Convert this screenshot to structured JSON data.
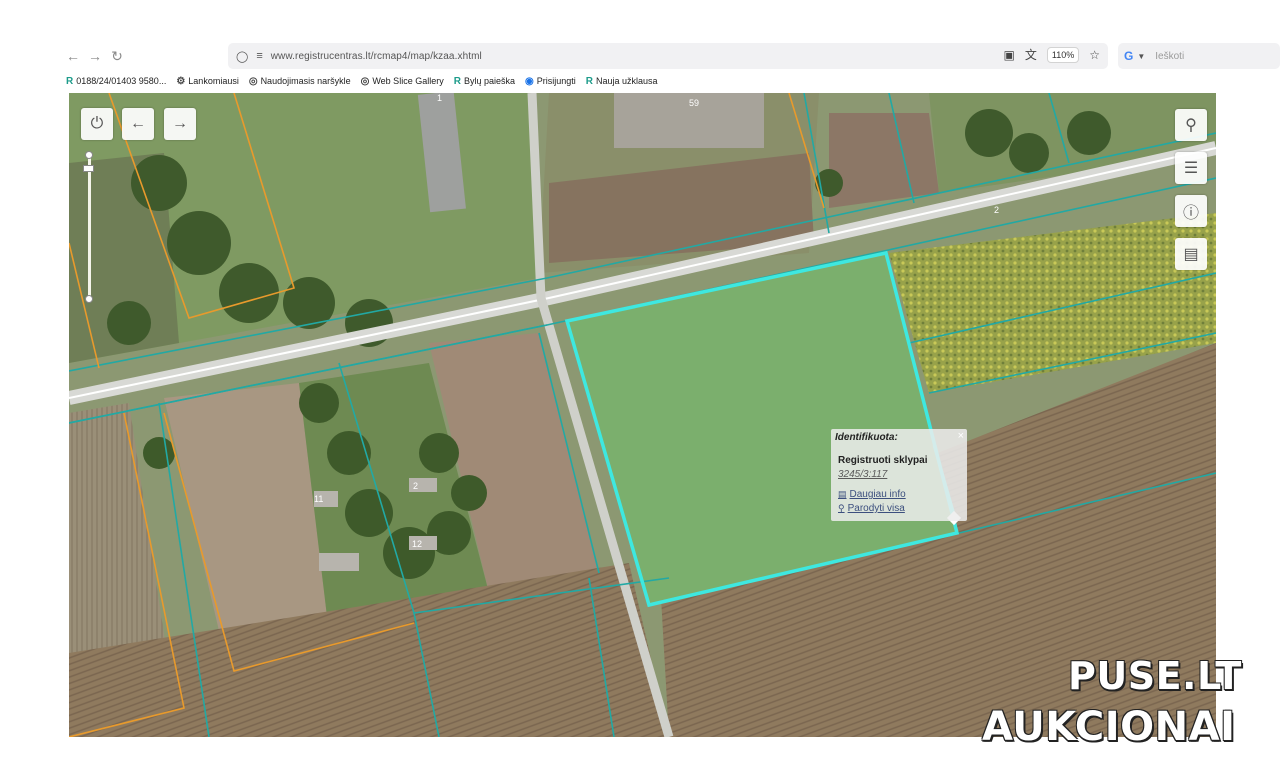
{
  "browser": {
    "url": "www.registrucentras.lt/rcmap4/map/kzaa.xhtml",
    "zoom": "110%",
    "search_placeholder": "Ieškoti",
    "search_engine": "G"
  },
  "bookmarks": [
    {
      "label": "0188/24/01403  9580...",
      "icon": "registrucentras-icon"
    },
    {
      "label": "Lankomiausi",
      "icon": "gear-icon"
    },
    {
      "label": "Naudojimasis naršykle",
      "icon": "globe-icon"
    },
    {
      "label": "Web Slice Gallery",
      "icon": "globe-icon"
    },
    {
      "label": "Bylų paieška",
      "icon": "registrucentras-icon"
    },
    {
      "label": "Prisijungti",
      "icon": "edge-icon"
    },
    {
      "label": "Nauja užklausa",
      "icon": "registrucentras-icon"
    }
  ],
  "map": {
    "parcel_labels": [
      "1",
      "59",
      "2",
      "11",
      "2",
      "12"
    ],
    "colors": {
      "selected_parcel": "#3ee8e0",
      "parcel_line": "#22a9a4",
      "boundary_line": "#e89a2c"
    }
  },
  "popup": {
    "title": "Identifikuota:",
    "close": "×",
    "heading": "Registruoti sklypai",
    "parcel_id": "3245/3:117",
    "more_info": "Daugiau info",
    "show_all": "Parodyti visa"
  },
  "watermark": {
    "line1": "PUSE.LT",
    "line2": "AUKCIONAI"
  }
}
